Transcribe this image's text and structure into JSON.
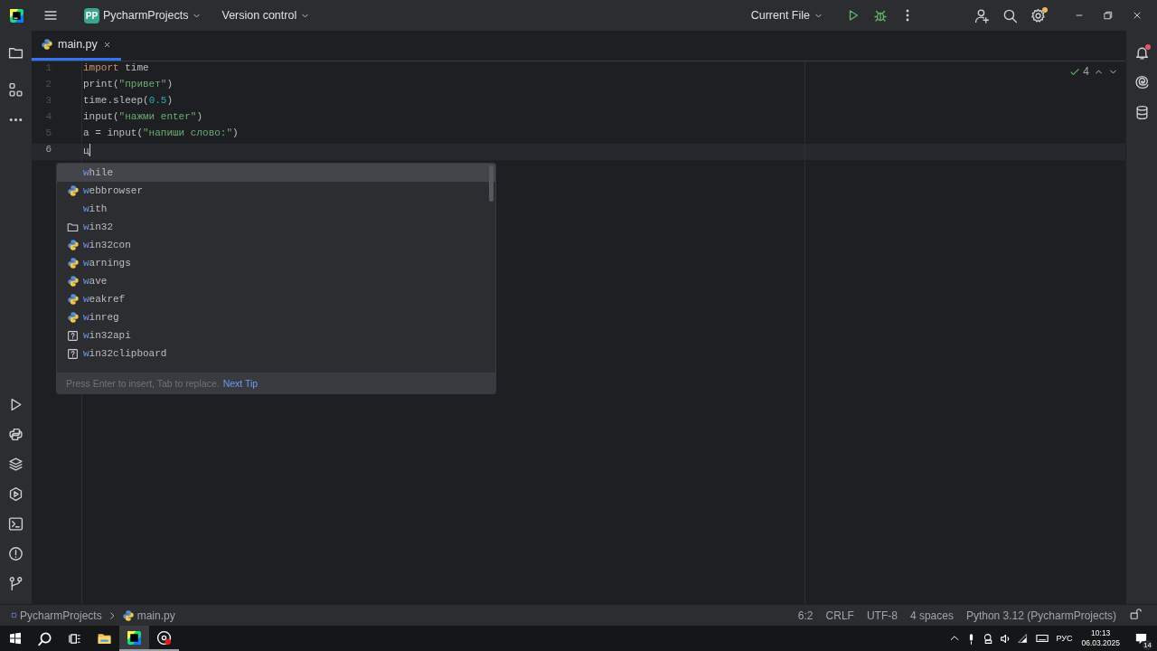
{
  "title_bar": {
    "project_badge": "PP",
    "project": "PycharmProjects",
    "vcs": "Version control",
    "run_config": "Current File"
  },
  "editor": {
    "tabs": [
      {
        "label": "main.py",
        "selected": true
      }
    ],
    "inspection_count": "4",
    "lines": [
      {
        "number": "1",
        "current": false,
        "tokens": [
          {
            "kind": "keyword",
            "text": "import"
          },
          {
            "kind": "plain",
            "text": " time"
          }
        ]
      },
      {
        "number": "2",
        "current": false,
        "tokens": [
          {
            "kind": "plain",
            "text": "print("
          },
          {
            "kind": "string",
            "text": "\"привет\""
          },
          {
            "kind": "plain",
            "text": ")"
          }
        ]
      },
      {
        "number": "3",
        "current": false,
        "tokens": [
          {
            "kind": "plain",
            "text": "time.sleep("
          },
          {
            "kind": "number",
            "text": "0.5"
          },
          {
            "kind": "plain",
            "text": ")"
          }
        ]
      },
      {
        "number": "4",
        "current": false,
        "tokens": [
          {
            "kind": "plain",
            "text": "input("
          },
          {
            "kind": "string",
            "text": "\"нажми enter\""
          },
          {
            "kind": "plain",
            "text": ")"
          }
        ]
      },
      {
        "number": "5",
        "current": false,
        "tokens": [
          {
            "kind": "plain",
            "text": "a = input("
          },
          {
            "kind": "string",
            "text": "\"напиши слово:\""
          },
          {
            "kind": "plain",
            "text": ")"
          }
        ]
      },
      {
        "number": "6",
        "current": true,
        "tokens": [
          {
            "kind": "plain",
            "text": "ц"
          }
        ]
      }
    ]
  },
  "completion": {
    "items": [
      {
        "text": "while",
        "kind": "keyword",
        "selected": true
      },
      {
        "text": "webbrowser",
        "kind": "module",
        "selected": false
      },
      {
        "text": "with",
        "kind": "keyword",
        "selected": false
      },
      {
        "text": "win32",
        "kind": "folder",
        "selected": false
      },
      {
        "text": "win32con",
        "kind": "module",
        "selected": false
      },
      {
        "text": "warnings",
        "kind": "module",
        "selected": false
      },
      {
        "text": "wave",
        "kind": "module",
        "selected": false
      },
      {
        "text": "weakref",
        "kind": "module",
        "selected": false
      },
      {
        "text": "winreg",
        "kind": "module",
        "selected": false
      },
      {
        "text": "win32api",
        "kind": "unknown",
        "selected": false
      },
      {
        "text": "win32clipboard",
        "kind": "unknown",
        "selected": false
      }
    ],
    "hint": "Press Enter to insert, Tab to replace.",
    "hint_link": "Next Tip"
  },
  "status_bar": {
    "breadcrumbs": [
      {
        "label": "PycharmProjects",
        "kind": "project"
      },
      {
        "label": "main.py",
        "kind": "file"
      }
    ],
    "items": [
      "6:2",
      "CRLF",
      "UTF-8",
      "4 spaces",
      "Python 3.12 (PycharmProjects)"
    ]
  },
  "taskbar": {
    "language": "РУС",
    "time": "10:13",
    "date": "06.03.2025",
    "notifications": "14"
  }
}
